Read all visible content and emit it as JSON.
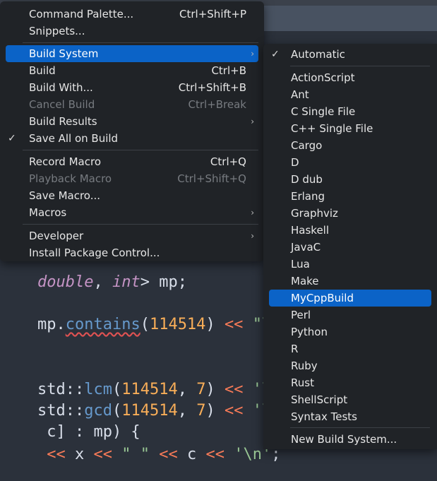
{
  "main_menu": {
    "items": [
      {
        "label": "Command Palette...",
        "shortcut": "Ctrl+Shift+P"
      },
      {
        "label": "Snippets...",
        "shortcut": ""
      },
      {
        "label": "Build System",
        "shortcut": ""
      },
      {
        "label": "Build",
        "shortcut": "Ctrl+B"
      },
      {
        "label": "Build With...",
        "shortcut": "Ctrl+Shift+B"
      },
      {
        "label": "Cancel Build",
        "shortcut": "Ctrl+Break"
      },
      {
        "label": "Build Results",
        "shortcut": ""
      },
      {
        "label": "Save All on Build",
        "shortcut": ""
      },
      {
        "label": "Record Macro",
        "shortcut": "Ctrl+Q"
      },
      {
        "label": "Playback Macro",
        "shortcut": "Ctrl+Shift+Q"
      },
      {
        "label": "Save Macro...",
        "shortcut": ""
      },
      {
        "label": "Macros",
        "shortcut": ""
      },
      {
        "label": "Developer",
        "shortcut": ""
      },
      {
        "label": "Install Package Control...",
        "shortcut": ""
      }
    ],
    "submenu_arrow": "›",
    "check_mark": "✓"
  },
  "build_system_menu": {
    "items": [
      "Automatic",
      "ActionScript",
      "Ant",
      "C Single File",
      "C++ Single File",
      "Cargo",
      "D",
      "D dub",
      "Erlang",
      "Graphviz",
      "Haskell",
      "JavaC",
      "Lua",
      "Make",
      "MyCppBuild",
      "Perl",
      "Python",
      "R",
      "Ruby",
      "Rust",
      "ShellScript",
      "Syntax Tests",
      "New Build System..."
    ],
    "check_mark": "✓"
  },
  "code": {
    "l1": [
      "double",
      ", ",
      "int",
      "> mp;"
    ],
    "l2": [
      "mp.",
      "contains",
      "(",
      "114514",
      ") ",
      "<<",
      " ",
      "\"\\n"
    ],
    "l3": [
      "std::",
      "lcm",
      "(",
      "114514",
      ", ",
      "7",
      ") ",
      "<<",
      " ",
      "'\\n"
    ],
    "l4": [
      "std::",
      "gcd",
      "(",
      "114514",
      ", ",
      "7",
      ") ",
      "<<",
      " ",
      "'\\n"
    ],
    "l5": [
      " c] : mp) {"
    ],
    "l6": [
      " ",
      "<<",
      " x ",
      "<<",
      " ",
      "\" \"",
      " ",
      "<<",
      " c ",
      "<<",
      " ",
      "'\\n'",
      ";"
    ]
  },
  "colors": {
    "selection": "#0b63c7",
    "menu_bg": "#202327",
    "editor_bg": "#2b313b",
    "keyword": "#f97b58",
    "function": "#6699cc",
    "number": "#f9ae58",
    "string": "#99c794"
  }
}
